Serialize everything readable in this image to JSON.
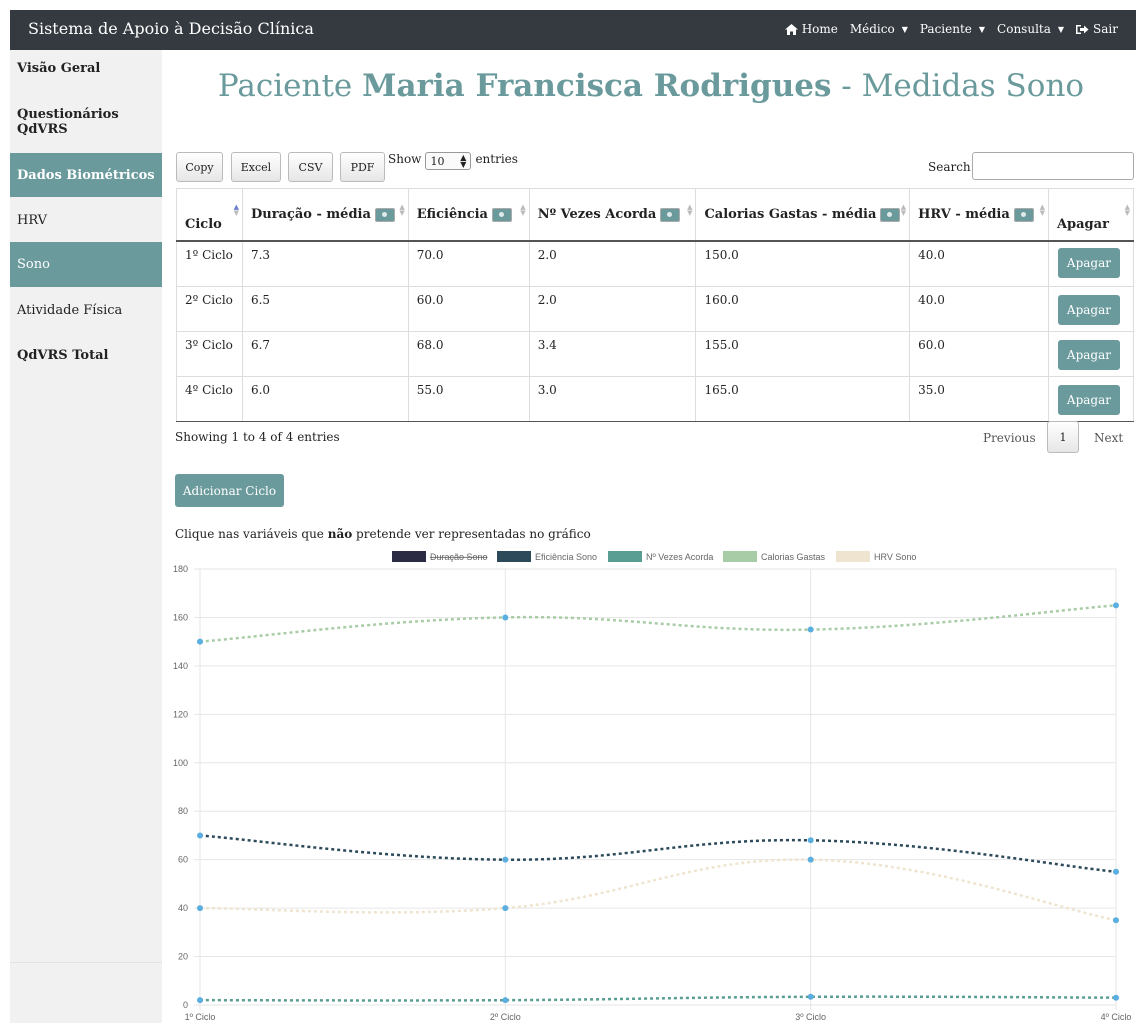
{
  "navbar": {
    "brand": "Sistema de Apoio à Decisão Clínica",
    "items": [
      {
        "label": "Home"
      },
      {
        "label": "Médico"
      },
      {
        "label": "Paciente"
      },
      {
        "label": "Consulta"
      },
      {
        "label": "Sair"
      }
    ]
  },
  "sidebar": {
    "items": [
      {
        "label": "Visão Geral"
      },
      {
        "label": "Questionários QdVRS"
      },
      {
        "label": "Dados Biométricos"
      },
      {
        "label": "HRV"
      },
      {
        "label": "Sono"
      },
      {
        "label": "Atividade Física"
      },
      {
        "label": "QdVRS Total"
      }
    ]
  },
  "title": {
    "prefix": "Paciente ",
    "name": "Maria Francisca Rodrigues",
    "suffix": " - Medidas Sono"
  },
  "toolbar": {
    "copy": "Copy",
    "excel": "Excel",
    "csv": "CSV",
    "pdf": "PDF",
    "show_prefix": "Show",
    "show_value": "10",
    "show_suffix": "entries",
    "search_label": "Search:",
    "search_value": ""
  },
  "table": {
    "headers": [
      "Ciclo",
      "Duração - média",
      "Eficiência",
      "Nº Vezes Acorda",
      "Calorias Gastas - média",
      "HRV - média",
      "Apagar"
    ],
    "rows": [
      [
        "1º Ciclo",
        "7.3",
        "70.0",
        "2.0",
        "150.0",
        "40.0"
      ],
      [
        "2º Ciclo",
        "6.5",
        "60.0",
        "2.0",
        "160.0",
        "40.0"
      ],
      [
        "3º Ciclo",
        "6.7",
        "68.0",
        "3.4",
        "155.0",
        "60.0"
      ],
      [
        "4º Ciclo",
        "6.0",
        "55.0",
        "3.0",
        "165.0",
        "35.0"
      ]
    ],
    "delete_label": "Apagar"
  },
  "footer": {
    "info": "Showing 1 to 4 of 4 entries",
    "previous": "Previous",
    "page": "1",
    "next": "Next"
  },
  "add_button": "Adicionar Ciclo",
  "chart_hint": {
    "before": "Clique nas variáveis que ",
    "bold": "não",
    "after": " pretende ver representadas no gráfico"
  },
  "colors": {
    "navbar": "#343a40",
    "accent": "#6a9a9c",
    "sidebar_bg": "#f1f1f1",
    "point": "#5aaee0"
  },
  "icons": {
    "home": "home-icon",
    "logout": "sign-out-icon"
  },
  "chart_data": {
    "type": "line",
    "categories": [
      "1º Ciclo",
      "2º Ciclo",
      "3º Ciclo",
      "4º Ciclo"
    ],
    "ylim": [
      0,
      180
    ],
    "yticks": [
      0,
      20,
      40,
      60,
      80,
      100,
      120,
      140,
      160,
      180
    ],
    "grid": true,
    "legend_position": "top",
    "series": [
      {
        "name": "Duração Sono",
        "values": [
          7.3,
          6.5,
          6.7,
          6.0
        ],
        "color": "#2b2b44",
        "hidden": true
      },
      {
        "name": "Eficiência Sono",
        "values": [
          70,
          60,
          68,
          55
        ],
        "color": "#2c4a5a",
        "hidden": false
      },
      {
        "name": "Nº Vezes Acorda",
        "values": [
          2.0,
          2.0,
          3.4,
          3.0
        ],
        "color": "#5a9e93",
        "hidden": false
      },
      {
        "name": "Calorias Gastas",
        "values": [
          150,
          160,
          155,
          165
        ],
        "color": "#a8cca6",
        "hidden": false
      },
      {
        "name": "HRV Sono",
        "values": [
          40,
          40,
          60,
          35
        ],
        "color": "#efe4cf",
        "hidden": false
      }
    ]
  }
}
